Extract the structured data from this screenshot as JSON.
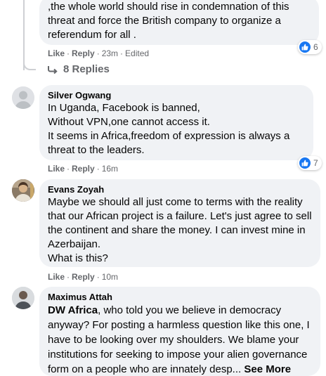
{
  "comment1": {
    "lines": [
      ",the whole world should rise in condemnation of this",
      "threat and force the British company to organize a",
      "referendum for all ."
    ],
    "like_label": "Like",
    "reply_label": "Reply",
    "time": "23m",
    "edited": "Edited",
    "reaction_count": "6",
    "replies_label": "8 Replies"
  },
  "comment2": {
    "author": "Silver Ogwang",
    "lines": [
      "In Uganda, Facebook is banned,",
      "Without VPN,one cannot access it.",
      "It seems in Africa,freedom of expression is always a",
      "threat to the leaders."
    ],
    "like_label": "Like",
    "reply_label": "Reply",
    "time": "16m",
    "reaction_count": "7"
  },
  "comment3": {
    "author": "Evans Zoyah",
    "lines": [
      "Maybe we should all just come to terms with the reality",
      "that our African project is a failure. Let's just agree to sell",
      "the continent and share the money. I can invest mine in",
      "Azerbaijan.",
      "What is this?"
    ],
    "like_label": "Like",
    "reply_label": "Reply",
    "time": "10m"
  },
  "comment4": {
    "author": "Maximus Attah",
    "mention": "DW Africa",
    "line1_rest": ", who told you we believe in democracy",
    "lines": [
      "anyway? For posting a harmless question like this one, I",
      "have to be looking over my shoulders. We blame your",
      "institutions for seeking to impose your alien governance"
    ],
    "last_line": "form on a people who are innately desp...",
    "see_more": "See More"
  },
  "colors": {
    "bubble": "#f0f2f5",
    "secondary_text": "#65676b",
    "like_blue": "#1877f2"
  }
}
